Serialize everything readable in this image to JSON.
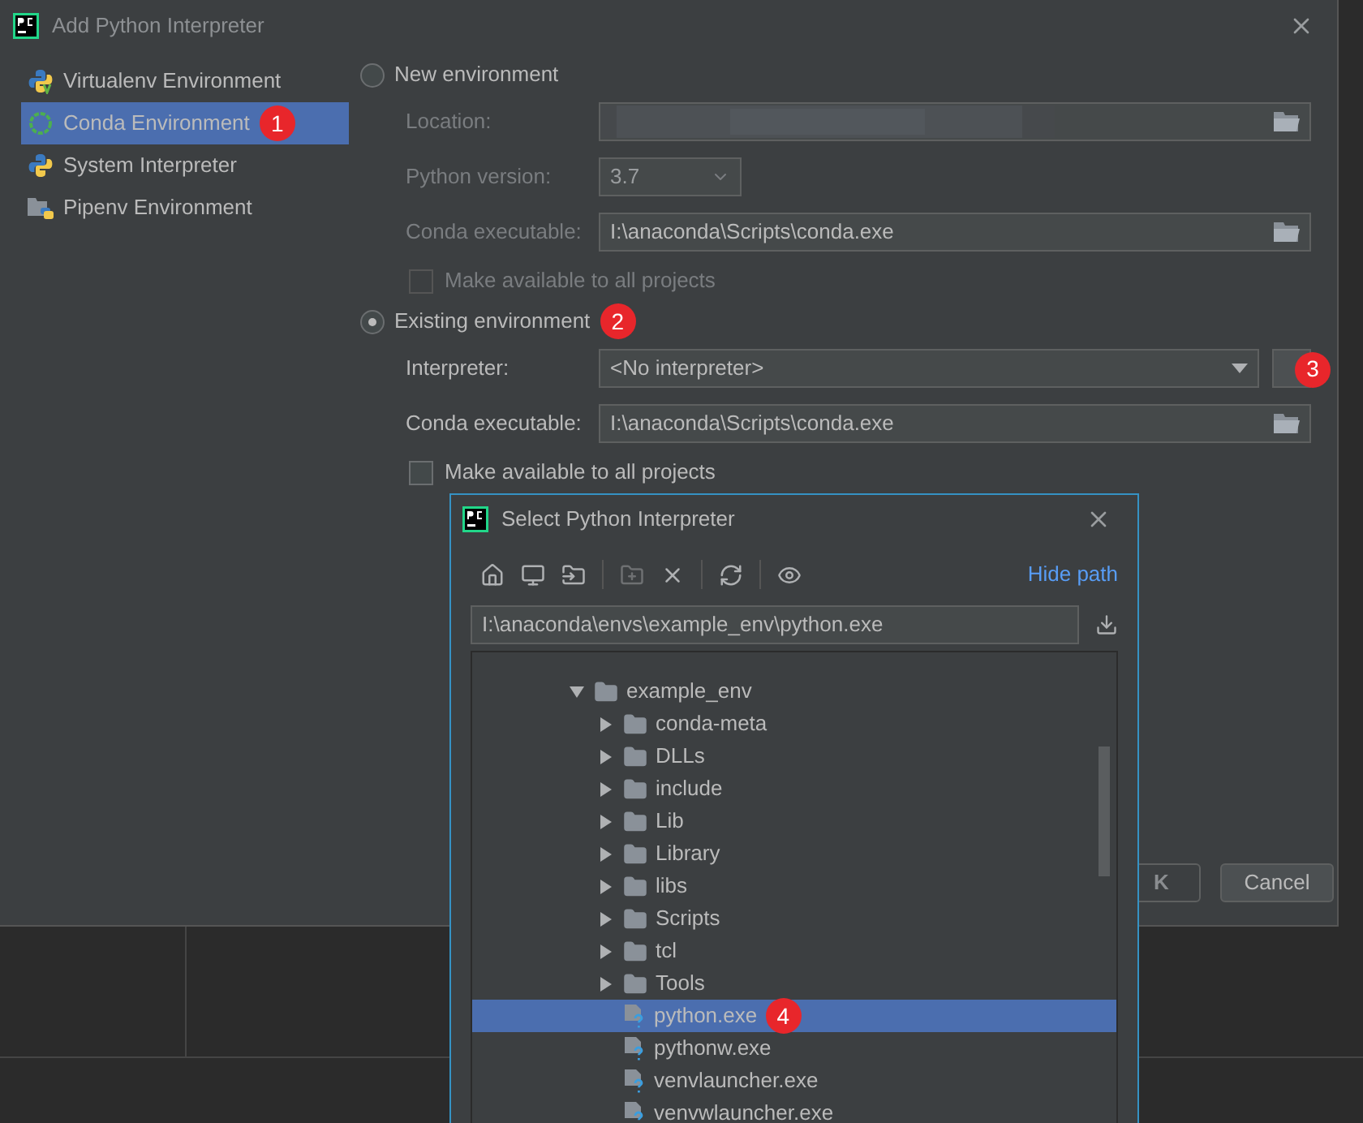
{
  "window": {
    "title": "Add Python Interpreter"
  },
  "sidebar": {
    "items": [
      {
        "label": "Virtualenv Environment",
        "kind": "virtualenv",
        "selected": false
      },
      {
        "label": "Conda Environment",
        "kind": "conda",
        "selected": true,
        "badge": "1"
      },
      {
        "label": "System Interpreter",
        "kind": "python",
        "selected": false
      },
      {
        "label": "Pipenv Environment",
        "kind": "pipenv",
        "selected": false
      }
    ]
  },
  "new_environment": {
    "label": "New environment",
    "selected": false,
    "fields": [
      {
        "label": "Location:",
        "kind": "blurred"
      },
      {
        "label": "Python version:",
        "kind": "dropdown",
        "value": "3.7"
      },
      {
        "label": "Conda executable:",
        "kind": "path",
        "value": "I:\\anaconda\\Scripts\\conda.exe"
      }
    ],
    "make_available": {
      "label": "Make available to all projects",
      "checked": false
    }
  },
  "existing_environment": {
    "label": "Existing environment",
    "selected": true,
    "badge": "2",
    "fields": [
      {
        "label": "Interpreter:",
        "kind": "dropdown-browse",
        "value": "<No interpreter>",
        "badge": "3"
      },
      {
        "label": "Conda executable:",
        "kind": "path",
        "value": "I:\\anaconda\\Scripts\\conda.exe"
      }
    ],
    "make_available": {
      "label": "Make available to all projects",
      "checked": false
    }
  },
  "buttons": [
    {
      "label": "K",
      "kind": "default"
    },
    {
      "label": "Cancel",
      "kind": "normal"
    }
  ],
  "file_dialog": {
    "title": "Select Python Interpreter",
    "hide_path": "Hide path",
    "path": "I:\\anaconda\\envs\\example_env\\python.exe",
    "tree": [
      {
        "label": "example_env",
        "kind": "folder",
        "expanded": true,
        "selected": false,
        "children": [
          {
            "label": "conda-meta",
            "kind": "folder",
            "expanded": false,
            "selected": false
          },
          {
            "label": "DLLs",
            "kind": "folder",
            "expanded": false,
            "selected": false
          },
          {
            "label": "include",
            "kind": "folder",
            "expanded": false,
            "selected": false
          },
          {
            "label": "Lib",
            "kind": "folder",
            "expanded": false,
            "selected": false
          },
          {
            "label": "Library",
            "kind": "folder",
            "expanded": false,
            "selected": false
          },
          {
            "label": "libs",
            "kind": "folder",
            "expanded": false,
            "selected": false
          },
          {
            "label": "Scripts",
            "kind": "folder",
            "expanded": false,
            "selected": false
          },
          {
            "label": "tcl",
            "kind": "folder",
            "expanded": false,
            "selected": false
          },
          {
            "label": "Tools",
            "kind": "folder",
            "expanded": false,
            "selected": false
          },
          {
            "label": "python.exe",
            "kind": "file",
            "selected": true,
            "badge": "4"
          },
          {
            "label": "pythonw.exe",
            "kind": "file",
            "selected": false
          },
          {
            "label": "venvlauncher.exe",
            "kind": "file",
            "selected": false
          },
          {
            "label": "venvwlauncher.exe",
            "kind": "file",
            "selected": false
          }
        ]
      }
    ]
  }
}
